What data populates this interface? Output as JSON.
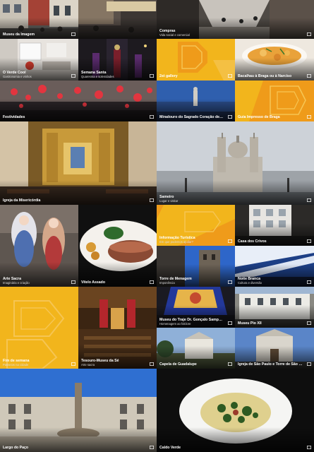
{
  "tiles": [
    {
      "title": "Museu da Imagem",
      "subtitle": "",
      "kind": "photo",
      "palette": "street1"
    },
    {
      "title": "Compras",
      "subtitle": "Vida social e comercial",
      "kind": "photo",
      "palette": "street2"
    },
    {
      "title": "O Verde Cool",
      "subtitle": "Gastronomia e vinhos",
      "kind": "photo",
      "palette": "shop"
    },
    {
      "title": "Semana Santa",
      "subtitle": "Quaresma e solenidades",
      "kind": "photo",
      "palette": "procession"
    },
    {
      "title": "2st gallery",
      "subtitle": "",
      "kind": "pattern"
    },
    {
      "title": "Bacalhau à Braga ou à Narciso",
      "subtitle": "",
      "kind": "photo",
      "palette": "food1"
    },
    {
      "title": "Festividades",
      "subtitle": "",
      "kind": "photo",
      "palette": "festival"
    },
    {
      "title": "Miradouro do Sagrado Coração de Jesus",
      "subtitle": "",
      "kind": "photo",
      "palette": "sky1"
    },
    {
      "title": "Guia Impresso de Braga",
      "subtitle": "",
      "kind": "pattern"
    },
    {
      "title": "Igreja da Misericórdia",
      "subtitle": "",
      "kind": "photo",
      "palette": "altar"
    },
    {
      "title": "Sameiro",
      "subtitle": "Lugar e visitar",
      "kind": "photo",
      "palette": "sameiro"
    },
    {
      "title": "Arte Sacra",
      "subtitle": "Imaginária e criação",
      "kind": "photo",
      "palette": "statues"
    },
    {
      "title": "Vitelo Assado",
      "subtitle": "",
      "kind": "photo",
      "palette": "food2"
    },
    {
      "title": "Informação Turística",
      "subtitle": "Em que podemos ajudar?",
      "kind": "pattern"
    },
    {
      "title": "Casa dos Crivos",
      "subtitle": "",
      "kind": "photo",
      "palette": "building"
    },
    {
      "title": "Torre de Menagem",
      "subtitle": "Imponência",
      "kind": "photo",
      "palette": "tower"
    },
    {
      "title": "Noite Branca",
      "subtitle": "Cultura e diversão",
      "kind": "photo",
      "palette": "night"
    },
    {
      "title": "Museu do Traje Dr. Gonçalo Sampaio",
      "subtitle": "Homenagem ao folclore",
      "kind": "photo",
      "palette": "costume"
    },
    {
      "title": "Museu Pio XII",
      "subtitle": "",
      "kind": "photo",
      "palette": "museum"
    },
    {
      "title": "Fim de semana",
      "subtitle": "Passeios na cidade",
      "kind": "pattern"
    },
    {
      "title": "Tesouro-Museu da Sé",
      "subtitle": "Arte sacra",
      "kind": "photo",
      "palette": "treasury"
    },
    {
      "title": "Capela de Guadalupe",
      "subtitle": "",
      "kind": "photo",
      "palette": "chapel"
    },
    {
      "title": "Igreja de São Paulo e Torre de São Tiago",
      "subtitle": "",
      "kind": "photo",
      "palette": "church"
    },
    {
      "title": "Largo do Paço",
      "subtitle": "",
      "kind": "photo",
      "palette": "paco"
    },
    {
      "title": "Caldo Verde",
      "subtitle": "",
      "kind": "photo",
      "palette": "soup"
    }
  ],
  "colors": {
    "accent_yellow": "#f2b51c",
    "accent_orange": "#ef9b1a",
    "background": "#111111"
  },
  "icons": {
    "tile_icon": "gallery-icon"
  }
}
